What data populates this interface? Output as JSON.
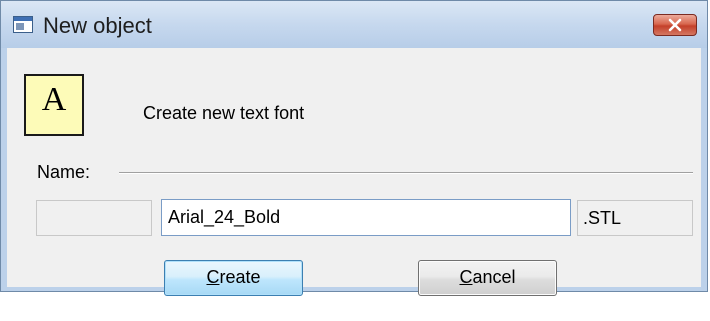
{
  "window": {
    "title": "New object",
    "icons": {
      "app": "window-icon",
      "close": "close-icon"
    }
  },
  "dialog": {
    "font_icon_letter": "A",
    "description": "Create new text font",
    "name_label": "Name:",
    "prefix_value": "",
    "name_value": "Arial_24_Bold",
    "extension": ".STL"
  },
  "buttons": {
    "create": {
      "accel": "C",
      "rest": "reate"
    },
    "cancel": {
      "accel": "C",
      "rest": "ancel"
    }
  },
  "colors": {
    "font_icon_bg": "#fdfbb8",
    "close_button": "#c4402a",
    "titlebar": "#c6d8ee",
    "default_button_border": "#3c7fb1"
  }
}
